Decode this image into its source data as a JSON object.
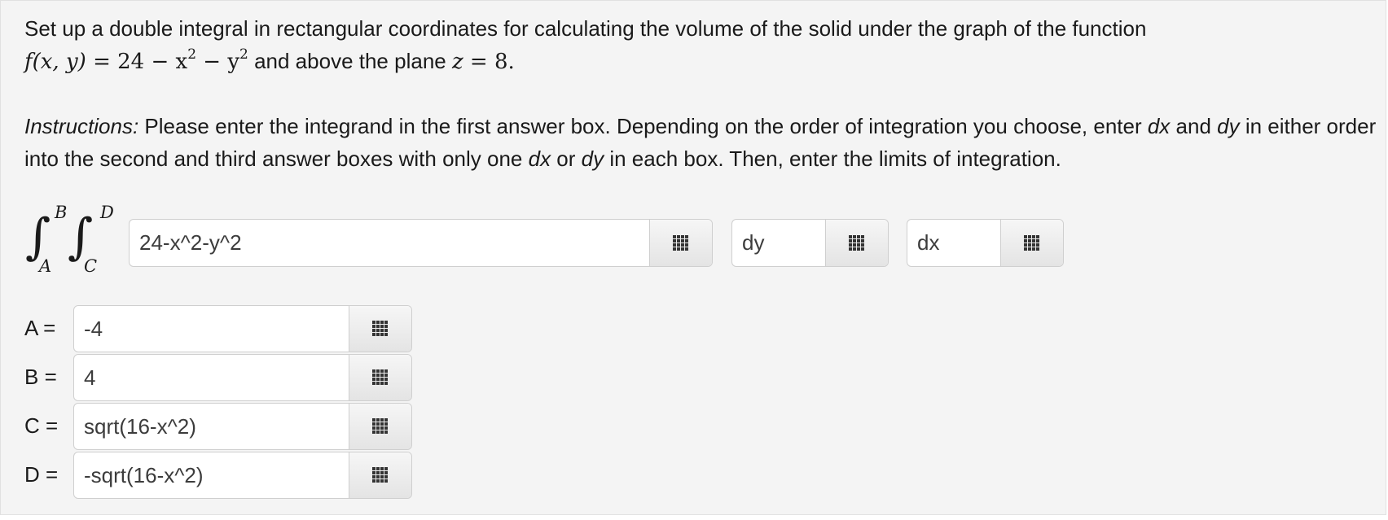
{
  "problem": {
    "text_before": "Set up a double integral in rectangular coordinates for calculating the volume of the solid under the graph of the function",
    "function_lhs": "f(x, y)",
    "function_rhs_a": "= 24 − x",
    "exp1": "2",
    "function_rhs_b": " − y",
    "exp2": "2",
    "text_middle": " and above the plane ",
    "plane_var": "z",
    "plane_value": " = 8."
  },
  "instructions": {
    "label": "Instructions:",
    "text1": " Please enter the integrand in the first answer box. Depending on the order of integration you choose, enter ",
    "dx1": "dx",
    "and": " and ",
    "dy1": "dy",
    "text2": " in either order into the second and third answer boxes with only one ",
    "dx2": "dx",
    "or": " or ",
    "dy2": "dy",
    "text3": " in each box. Then, enter the limits of integration."
  },
  "integral": {
    "outer_upper": "B",
    "outer_lower": "A",
    "inner_upper": "D",
    "inner_lower": "C",
    "symbol": "∫"
  },
  "answers": {
    "integrand": "24-x^2-y^2",
    "differential_1": "dy",
    "differential_2": "dx"
  },
  "limits": [
    {
      "label": "A =",
      "value": "-4"
    },
    {
      "label": "B =",
      "value": "4"
    },
    {
      "label": "C =",
      "value": "sqrt(16-x^2)"
    },
    {
      "label": "D =",
      "value": "-sqrt(16-x^2)"
    }
  ],
  "icons": {
    "palette_button": "grid-icon"
  }
}
